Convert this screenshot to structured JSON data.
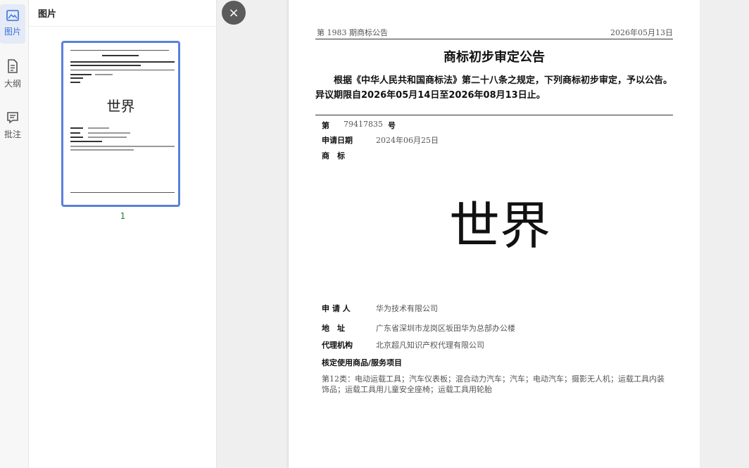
{
  "sidebar": {
    "items": [
      {
        "label": "图片",
        "icon": "image-icon",
        "active": true
      },
      {
        "label": "大纲",
        "icon": "document-icon",
        "active": false
      },
      {
        "label": "批注",
        "icon": "comment-icon",
        "active": false
      }
    ]
  },
  "thumbnails": {
    "header": "图片",
    "page_number": "1",
    "thumb_mark": "世界"
  },
  "close": {
    "label": "×"
  },
  "document": {
    "issue": "第 1983 期商标公告",
    "date": "2026年05月13日",
    "title": "商标初步审定公告",
    "intro": "根据《中华人民共和国商标法》第二十八条之规定，下列商标初步审定，予以公告。异议期限自2026年05月14日至2026年08月13日止。",
    "reg_no_label": "第",
    "reg_no": "79417835",
    "reg_no_suffix": "号",
    "apply_date_label": "申请日期",
    "apply_date": "2024年06月25日",
    "mark_label": "商　标",
    "mark": "世界",
    "applicant_label": "申 请 人",
    "applicant": "华为技术有限公司",
    "address_label": "地　址",
    "address": "广东省深圳市龙岗区坂田华为总部办公楼",
    "agent_label": "代理机构",
    "agent": "北京超凡知识产权代理有限公司",
    "goods_label": "核定使用商品/服务项目",
    "goods": "第12类：电动运载工具；汽车仪表板；混合动力汽车；汽车；电动汽车；摄影无人机；运载工具内装饰品；运载工具用儿童安全座椅；运载工具用轮胎"
  },
  "colors": {
    "accent": "#3b6fd6",
    "thumb_border": "#5b80d9",
    "page_number": "#2e7d32"
  }
}
